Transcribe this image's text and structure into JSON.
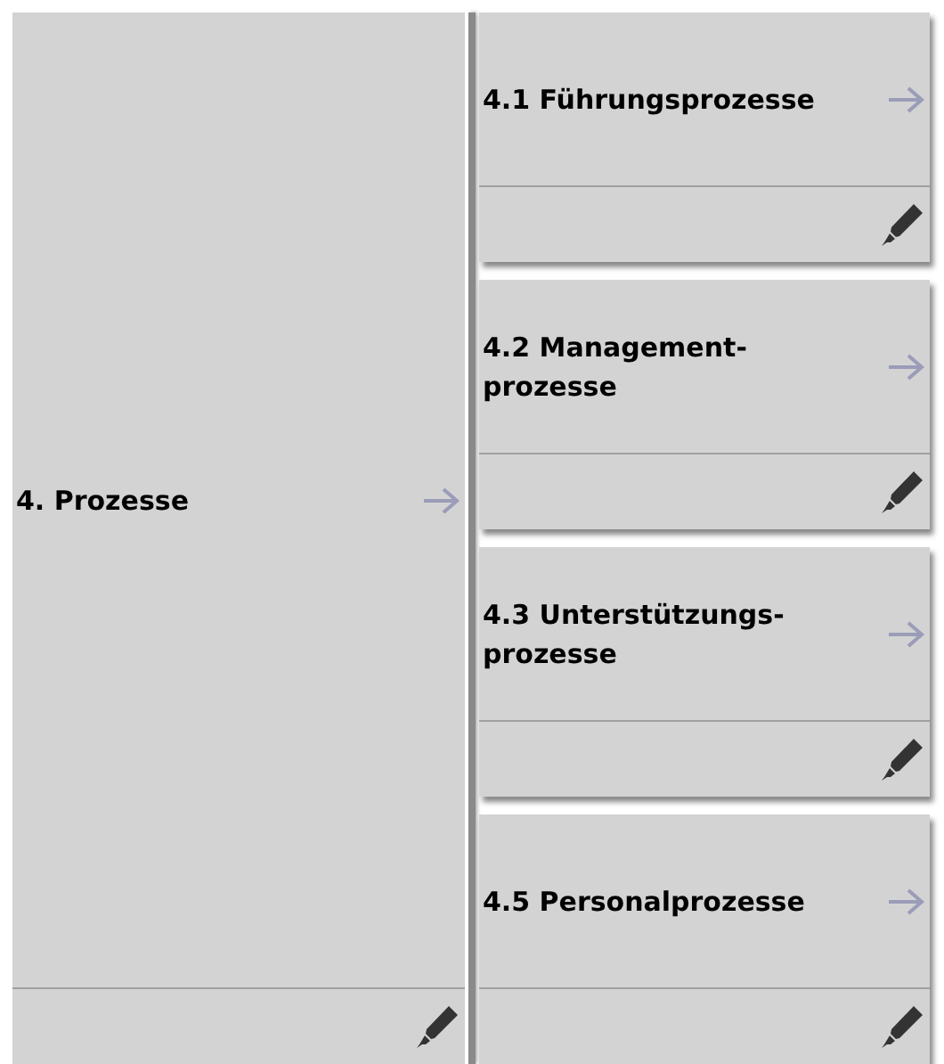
{
  "main_tile": {
    "title": "4. Prozesse"
  },
  "sub_tiles": [
    {
      "title": "4.1 Führungsprozesse"
    },
    {
      "title": "4.2 Management-\nprozesse"
    },
    {
      "title": "4.3 Unterstützungs-\nprozesse"
    },
    {
      "title": "4.5 Personalprozesse"
    }
  ]
}
